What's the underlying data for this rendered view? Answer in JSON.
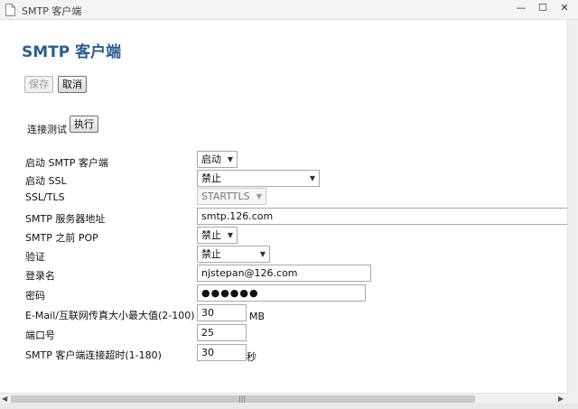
{
  "window": {
    "title": "SMTP 客户端",
    "minimize_glyph": "—",
    "maximize_glyph": "☐",
    "close_glyph": "✕"
  },
  "page": {
    "title": "SMTP 客户端"
  },
  "actions": {
    "save_label": "保存",
    "cancel_label": "取消"
  },
  "connection_test": {
    "label": "连接测试",
    "run_label": "执行"
  },
  "form": {
    "enable_smtp": {
      "label": "启动 SMTP 客户端",
      "value": "启动"
    },
    "enable_ssl": {
      "label": "启动 SSL",
      "value": "禁止"
    },
    "ssl_tls": {
      "label": "SSL/TLS",
      "value": "STARTTLS"
    },
    "server_address": {
      "label": "SMTP 服务器地址",
      "value": "smtp.126.com"
    },
    "pop_before_smtp": {
      "label": "SMTP 之前 POP",
      "value": "禁止"
    },
    "auth": {
      "label": "验证",
      "value": "禁止"
    },
    "login_name": {
      "label": "登录名",
      "value": "njstepan@126.com"
    },
    "password": {
      "label": "密码",
      "value": "●●●●●●"
    },
    "max_size": {
      "label": "E-Mail/互联网传真大小最大值(2-100)",
      "value": "30",
      "unit": "MB"
    },
    "port": {
      "label": "端口号",
      "value": "25"
    },
    "timeout": {
      "label": "SMTP 客户端连接超时(1-180)",
      "value": "30",
      "unit": "秒"
    }
  },
  "icons": {
    "caret": "▼",
    "scroll_left": "◀",
    "scroll_right": "▶",
    "grip": "|||"
  }
}
